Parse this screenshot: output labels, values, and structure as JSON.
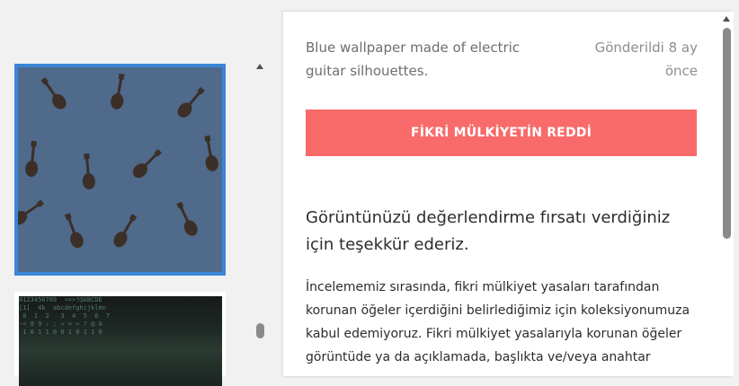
{
  "submission": {
    "description": "Blue wallpaper made of electric guitar silhouettes.",
    "sent_time": "Gönderildi 8 ay önce",
    "status_label": "FİKRİ MÜLKİYETİN REDDİ",
    "status_color": "#f96a6a"
  },
  "message": {
    "thanks": "Görüntünüzü değerlendirme fırsatı verdiğiniz için teşekkür ederiz.",
    "body": "İncelememiz sırasında, fikri mülkiyet yasaları tarafından korunan öğeler içerdiğini belirlediğimiz için koleksiyonumuza kabul edemiyoruz. Fikri mülkiyet yasalarıyla korunan öğeler görüntüde ya da açıklamada, başlıkta ve/veya anahtar"
  },
  "thumbnails": {
    "selected_border_color": "#3a86d6",
    "second_matrix_text": "0123456789  <=>?@ABCDE\n[1]  4k  abcdefghijklmn\n 0  1  2   3  4  5  6  7\n-< 8 9 : ; < = > ? @ A\n 1 0 1 1 0 0 1 0 1 1 0"
  }
}
